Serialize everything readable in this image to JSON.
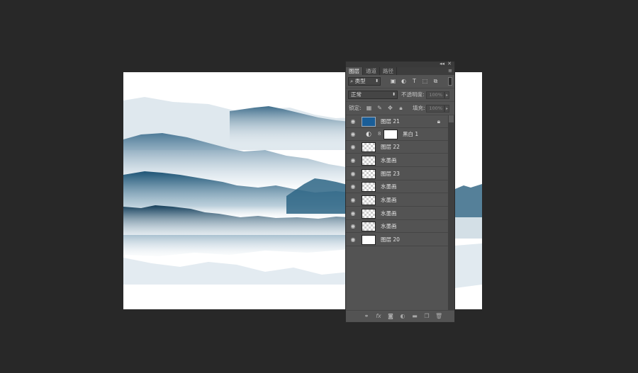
{
  "panel": {
    "tabs": [
      "图层",
      "通道",
      "路径"
    ],
    "active_tab": "图层",
    "filter": {
      "value": "类型"
    },
    "blend_mode": "正常",
    "opacity_label": "不透明度:",
    "opacity_value": "100%",
    "lock_label": "锁定:",
    "fill_label": "填充:",
    "fill_value": "100%"
  },
  "layers": [
    {
      "name": "图层 21",
      "thumb": "blue",
      "locked": true
    },
    {
      "name": "黑白 1",
      "thumb": "adjustment",
      "locked": false
    },
    {
      "name": "图层 22",
      "thumb": "checker",
      "locked": false
    },
    {
      "name": "水墨画",
      "thumb": "checker",
      "locked": false
    },
    {
      "name": "图层 23",
      "thumb": "checker",
      "locked": false
    },
    {
      "name": "水墨画",
      "thumb": "checker",
      "locked": false
    },
    {
      "name": "水墨画",
      "thumb": "checker",
      "locked": false
    },
    {
      "name": "水墨画",
      "thumb": "checker",
      "locked": false
    },
    {
      "name": "水墨画",
      "thumb": "checker",
      "locked": false
    },
    {
      "name": "图层 20",
      "thumb": "white",
      "locked": false
    }
  ],
  "icons": {
    "filter": [
      "image-filter-icon",
      "adjustment-filter-icon",
      "type-filter-icon",
      "shape-filter-icon",
      "smart-object-filter-icon"
    ],
    "lock": [
      "lock-transparent-icon",
      "lock-image-icon",
      "lock-position-icon",
      "lock-all-icon"
    ],
    "footer": [
      "link-layers-icon",
      "fx-icon",
      "add-mask-icon",
      "new-adjustment-icon",
      "new-group-icon",
      "new-layer-icon",
      "delete-layer-icon"
    ]
  },
  "colors": {
    "workspace": "#282828",
    "panel": "#535353",
    "ink": "#1f5778"
  }
}
